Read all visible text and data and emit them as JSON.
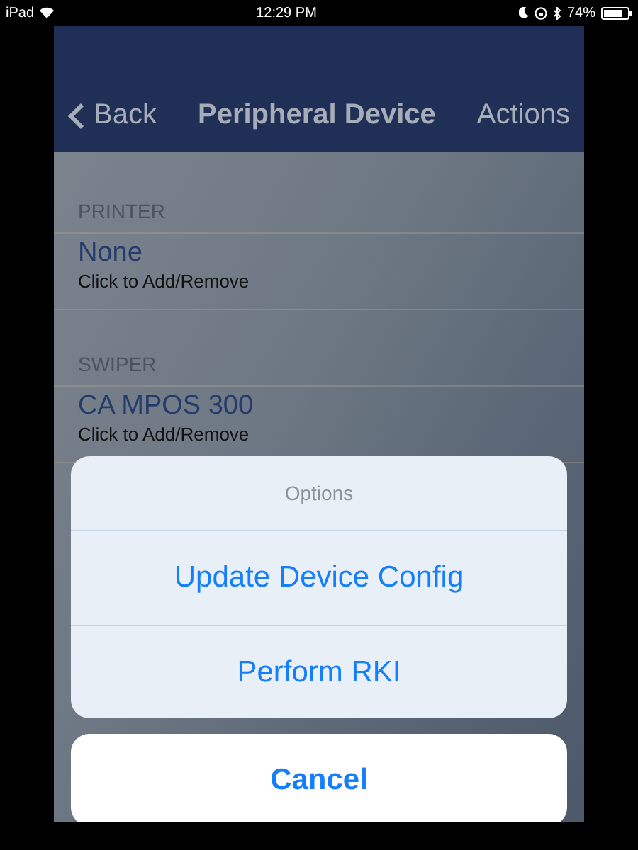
{
  "status_bar": {
    "device": "iPad",
    "time": "12:29 PM",
    "battery": "74%"
  },
  "nav_bar": {
    "back": "Back",
    "title": "Peripheral Device",
    "action": "Actions"
  },
  "sections": [
    {
      "header": "PRINTER",
      "value": "None",
      "hint": "Click to Add/Remove"
    },
    {
      "header": "SWIPER",
      "value": "CA MPOS 300",
      "hint": "Click to Add/Remove"
    }
  ],
  "action_sheet": {
    "title": "Options",
    "actions": [
      "Update Device Config",
      "Perform RKI"
    ],
    "cancel": "Cancel"
  }
}
